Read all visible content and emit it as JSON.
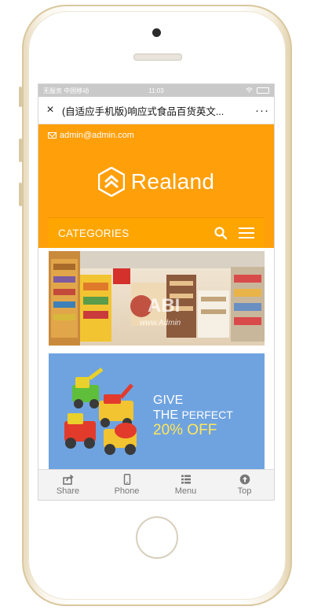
{
  "status_bar": {
    "carrier": "无服务 中国移动",
    "time": "11:03"
  },
  "title_bar": {
    "close_label": "×",
    "title": "(自适应手机版)响应式食品百货英文...",
    "more_label": "···"
  },
  "topbar": {
    "email": "admin@admin.com"
  },
  "brand": {
    "name": "Realand"
  },
  "categories_bar": {
    "label": "CATEGORIES"
  },
  "banner": {
    "watermark": "ABI",
    "watermark_url": "www.Admin"
  },
  "promo": {
    "line1": "GIVE",
    "line2_prefix": "THE ",
    "line2_suffix": "PERFECT",
    "line3": "20% OFF"
  },
  "bottom_nav": [
    {
      "label": "Share",
      "icon": "share-icon"
    },
    {
      "label": "Phone",
      "icon": "phone-icon"
    },
    {
      "label": "Menu",
      "icon": "menu-grid-icon"
    },
    {
      "label": "Top",
      "icon": "arrow-up-circle-icon"
    }
  ],
  "colors": {
    "brand_orange": "#ff9f0a",
    "promo_blue": "#6fa3e0",
    "promo_accent": "#ffe65a"
  }
}
